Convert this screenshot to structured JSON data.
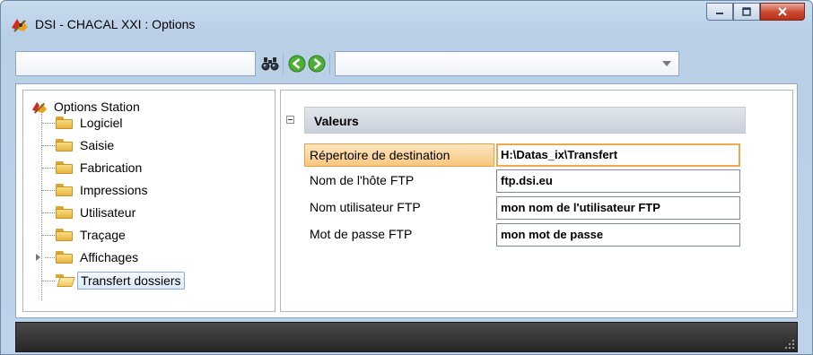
{
  "window": {
    "title": "DSI - CHACAL XXI : Options",
    "buttons": {
      "minimize": "minimize",
      "maximize": "maximize",
      "close": "close"
    }
  },
  "toolbar": {
    "search_value": "",
    "combo_value": "",
    "icons": [
      "binoculars-icon",
      "back-arrow-icon",
      "forward-arrow-icon"
    ]
  },
  "tree": {
    "root_label": "Options Station",
    "items": [
      {
        "label": "Logiciel"
      },
      {
        "label": "Saisie"
      },
      {
        "label": "Fabrication"
      },
      {
        "label": "Impressions"
      },
      {
        "label": "Utilisateur"
      },
      {
        "label": "Traçage"
      },
      {
        "label": "Affichages",
        "expandable": true
      },
      {
        "label": "Transfert dossiers",
        "selected": true
      }
    ]
  },
  "properties": {
    "category": "Valeurs",
    "rows": [
      {
        "name": "Répertoire de destination",
        "value": "H:\\Datas_ix\\Transfert",
        "active": true
      },
      {
        "name": "Nom de l'hôte FTP",
        "value": "ftp.dsi.eu"
      },
      {
        "name": "Nom utilisateur FTP",
        "value": "mon nom de l'utilisateur FTP"
      },
      {
        "name": "Mot de passe FTP",
        "value": "mon mot de passe"
      }
    ]
  },
  "colors": {
    "titlebar": "#c7daee",
    "close_button": "#c9462d",
    "selection_highlight": "#f7c77f",
    "statusbar": "#262626"
  }
}
